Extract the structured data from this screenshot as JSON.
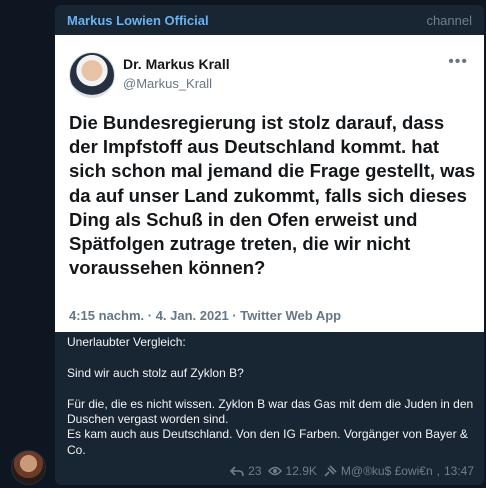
{
  "channel": {
    "name": "Markus Lowien Official",
    "tag": "channel"
  },
  "tweet": {
    "name": "Dr. Markus Krall",
    "handle": "@Markus_Krall",
    "more_icon": "more-horizontal-icon",
    "body": "Die Bundesregierung ist stolz darauf, dass der Impfstoff aus Deutschland kommt. hat sich schon mal jemand die Frage gestellt, was da auf unser Land zukommt, falls sich dieses Ding als Schuß in den Ofen erweist und Spätfolgen zutrage treten, die wir nicht voraussehen können?",
    "meta": "4:15 nachm. · 4. Jan. 2021 · Twitter Web App"
  },
  "caption": "Unerlaubter Vergleich:\n\nSind wir auch stolz auf Zyklon B?\n\nFür die, die es nicht wissen. Zyklon B war das Gas mit dem die Juden in den Duschen vergast worden sind.\nEs kam auch aus Deutschland. Von den IG Farben. Vorgänger von Bayer & Co.",
  "footer": {
    "replies": "23",
    "views": "12.9K",
    "author": "M@®ku$ £owi€n",
    "time": "13:47"
  }
}
